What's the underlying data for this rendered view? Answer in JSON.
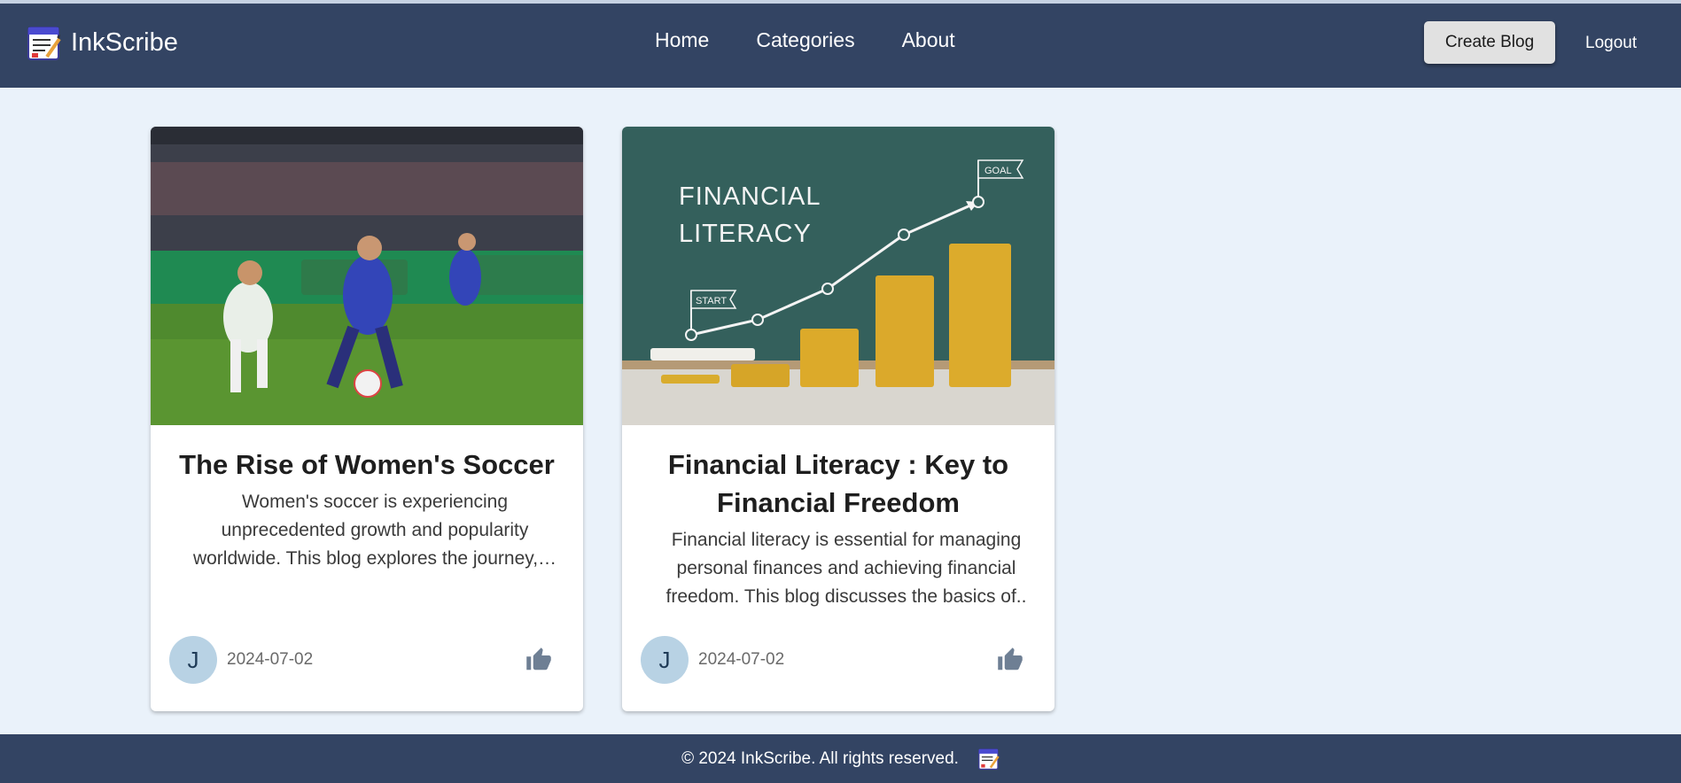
{
  "app": {
    "name": "InkScribe",
    "logo_icon": "notepad-pencil-icon"
  },
  "nav": {
    "links": [
      "Home",
      "Categories",
      "About"
    ],
    "create_label": "Create Blog",
    "logout_label": "Logout"
  },
  "posts": [
    {
      "title": "The Rise of Women's Soccer",
      "excerpt": "Women's soccer is experiencing unprecedented growth and popularity worldwide. This blog explores the journey,…",
      "image": "soccer-match-photo",
      "author_initial": "J",
      "date": "2024-07-02",
      "like_icon": "thumbs-up-icon"
    },
    {
      "title": "Financial Literacy : Key to Financial Freedom",
      "excerpt": "Financial literacy is essential for managing personal finances and achieving financial freedom. This blog discusses the basics of..",
      "image": "financial-literacy-chalkboard-photo",
      "image_text": {
        "headline": [
          "FINANCIAL",
          "LITERACY"
        ],
        "start_flag": "START",
        "goal_flag": "GOAL"
      },
      "author_initial": "J",
      "date": "2024-07-02",
      "like_icon": "thumbs-up-icon"
    }
  ],
  "footer": {
    "text": "© 2024 InkScribe. All rights reserved."
  },
  "colors": {
    "navbar": "#334463",
    "page_bg": "#eaf2fa",
    "avatar_bg": "#b8d2e4",
    "like_icon": "#6e7f94"
  }
}
